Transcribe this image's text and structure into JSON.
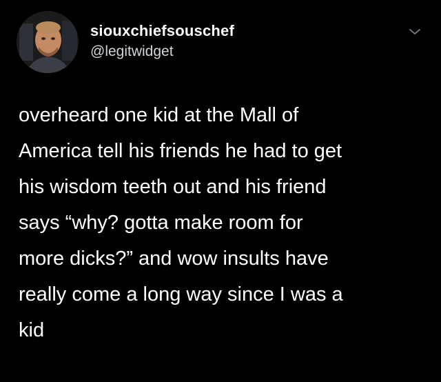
{
  "tweet": {
    "display_name": "siouxchiefsouschef",
    "handle": "@legitwidget",
    "body_lines": [
      "overheard one kid at the Mall of",
      "America tell his friends he had to get",
      "his wisdom teeth out and his friend",
      "says “why? gotta make room for",
      "more dicks?” and wow insults have",
      "really come a long way since I was a",
      "kid"
    ]
  },
  "icons": {
    "avatar": "profile-avatar",
    "menu": "chevron-down-icon"
  },
  "colors": {
    "background": "#000000",
    "text": "#ffffff",
    "handle_text": "#cfd6dc",
    "chevron": "#6e767d"
  }
}
